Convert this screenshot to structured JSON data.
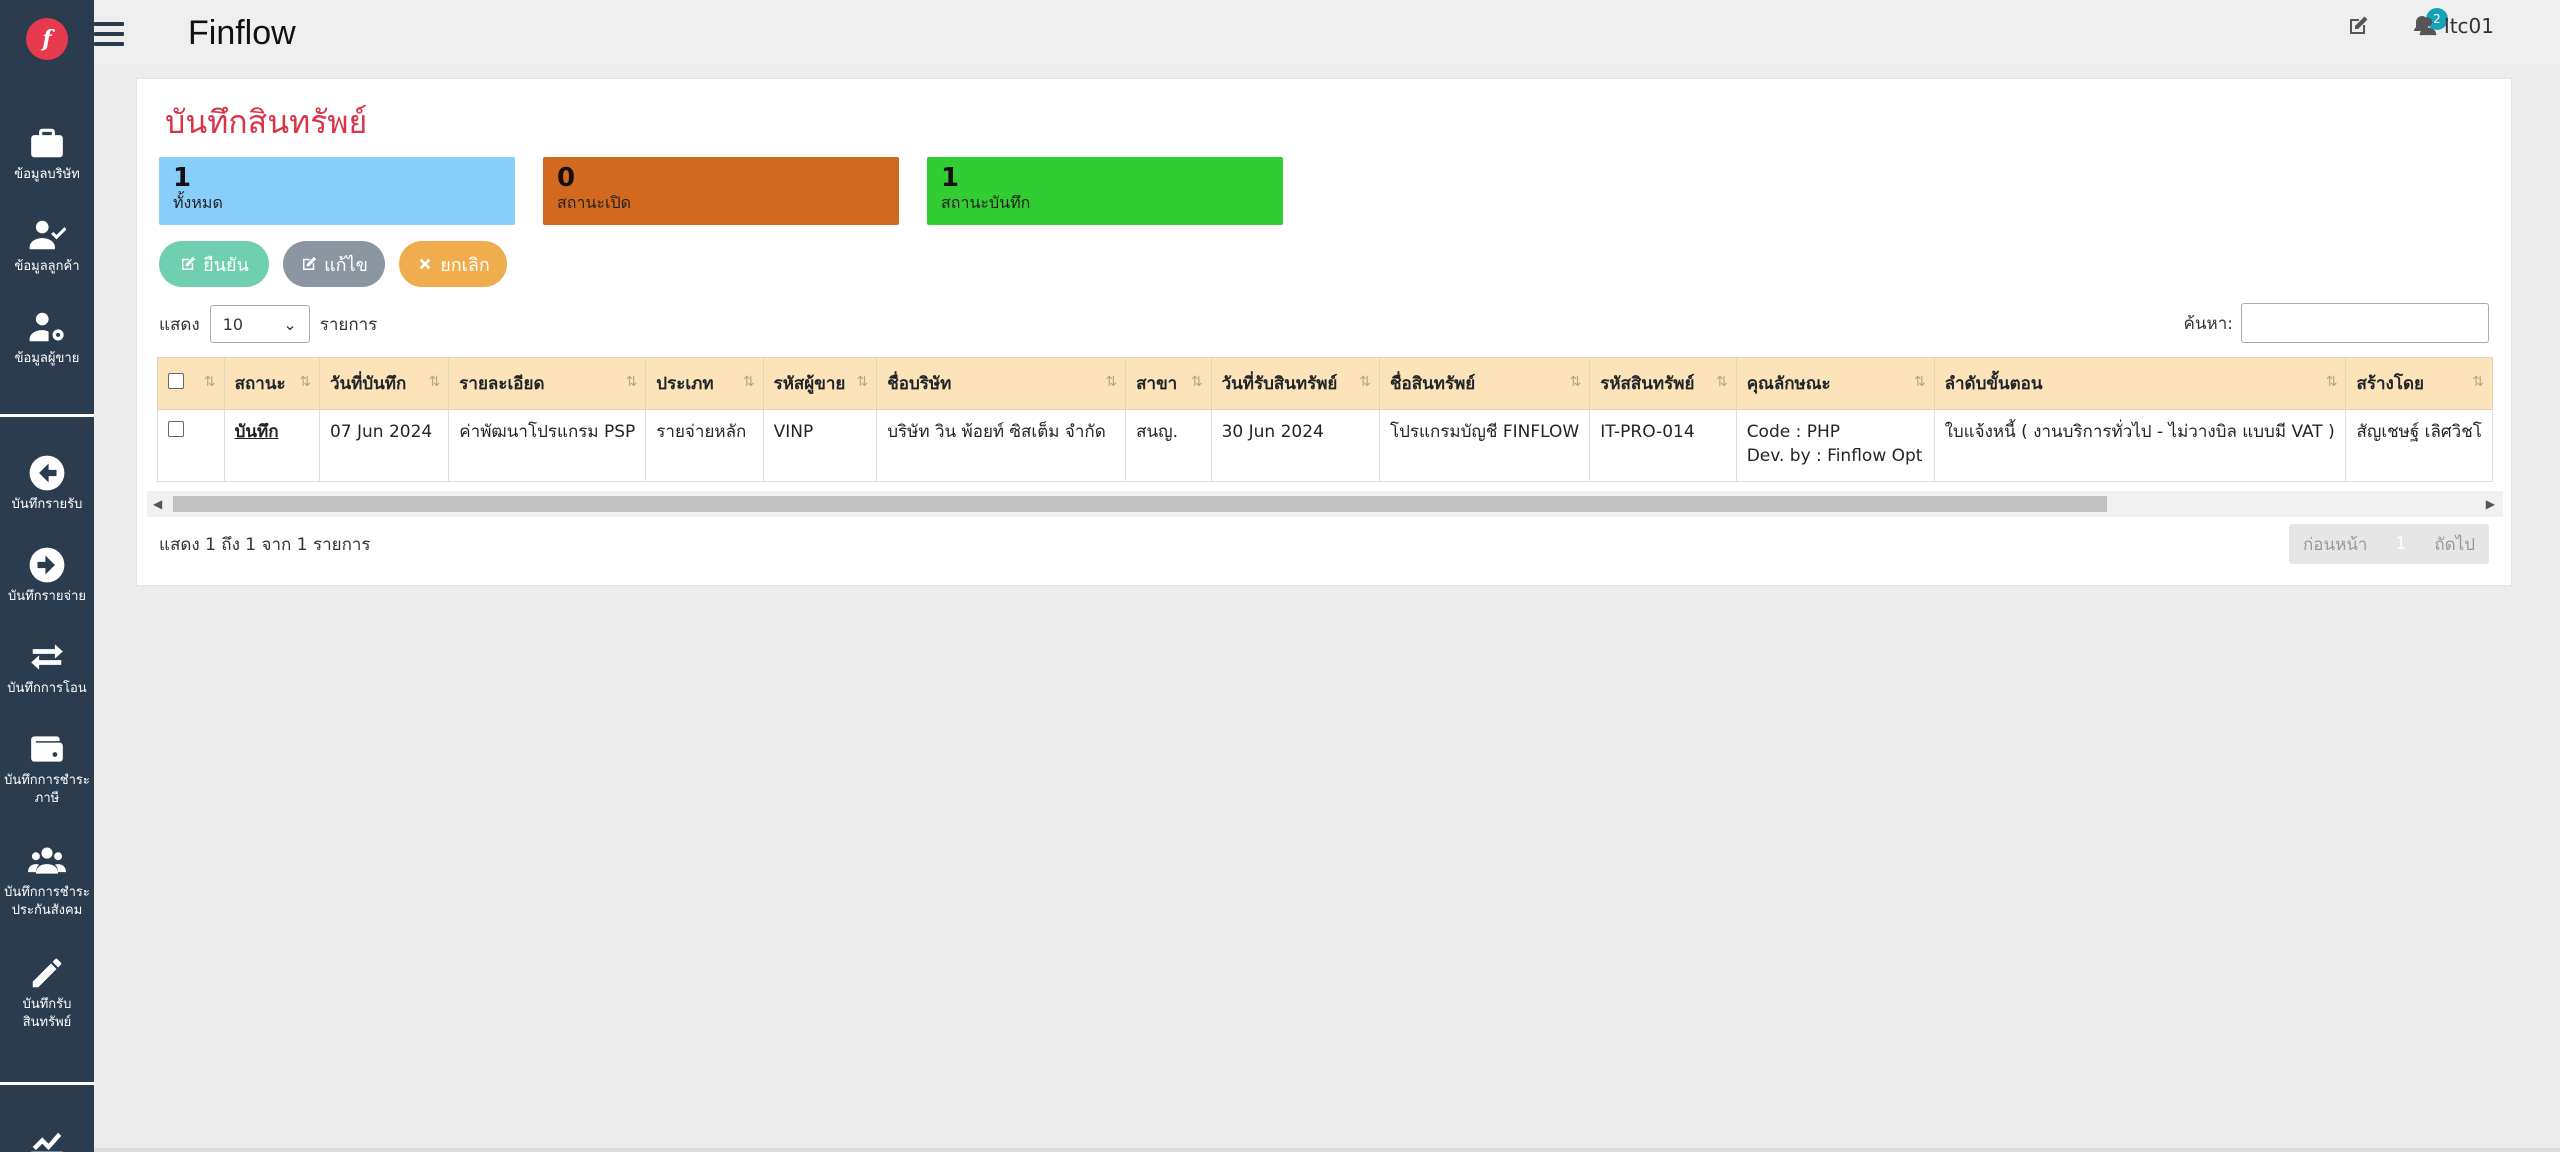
{
  "app": {
    "brand": "Finflow",
    "logo_letter": "f",
    "accent": "#d9344a"
  },
  "sidebar": {
    "items": [
      {
        "label": "ข้อมูลบริษัท",
        "icon": "briefcase-icon"
      },
      {
        "label": "ข้อมูลลูกค้า",
        "icon": "user-check-icon"
      },
      {
        "label": "ข้อมูลผู้ขาย",
        "icon": "user-gear-icon"
      },
      {
        "label": "บันทึกรายรับ",
        "icon": "arrow-left-circle-icon"
      },
      {
        "label": "บันทึกรายจ่าย",
        "icon": "arrow-right-circle-icon"
      },
      {
        "label": "บันทึกการโอน",
        "icon": "exchange-icon"
      },
      {
        "label": "บันทึกการชำระภาษี",
        "icon": "wallet-icon"
      },
      {
        "label": "บันทึกการชำระประกันสังคม",
        "icon": "users-icon"
      },
      {
        "label": "บันทึกรับสินทรัพย์",
        "icon": "pencil-icon"
      },
      {
        "label": "",
        "icon": "chart-line-icon"
      }
    ]
  },
  "topbar": {
    "notification_count": "2",
    "username": "Itc01"
  },
  "page": {
    "title": "บันทึกสินทรัพย์"
  },
  "stats": [
    {
      "value": "1",
      "label": "ทั้งหมด",
      "color": "#87cefa"
    },
    {
      "value": "0",
      "label": "สถานะเปิด",
      "color": "#d2691e"
    },
    {
      "value": "1",
      "label": "สถานะบันทึก",
      "color": "#32cd32"
    }
  ],
  "actions": {
    "confirm": "ยืนยัน",
    "edit": "แก้ไข",
    "cancel": "ยกเลิก"
  },
  "table_controls": {
    "show_label": "แสดง",
    "page_size": "10",
    "entries_label": "รายการ",
    "search_label": "ค้นหา:",
    "search_value": ""
  },
  "table": {
    "headers": [
      "สถานะ",
      "วันที่บันทึก",
      "รายละเอียด",
      "ประเภท",
      "รหัสผู้ขาย",
      "ชื่อบริษัท",
      "สาขา",
      "วันที่รับสินทรัพย์",
      "ชื่อสินทรัพย์",
      "รหัสสินทรัพย์",
      "คุณลักษณะ",
      "ลำดับขั้นตอน",
      "สร้างโดย"
    ],
    "rows": [
      {
        "status": "บันทึก",
        "record_date": "07 Jun 2024",
        "detail": "ค่าพัฒนาโปรแกรม PSP",
        "type": "รายจ่ายหลัก",
        "vendor_code": "VINP",
        "company": "บริษัท วิน พ้อยท์ ซิสเต็ม จำกัด",
        "branch": "สนญ.",
        "receive_date": "30 Jun 2024",
        "asset_name": "โปรแกรมบัญชี FINFLOW",
        "asset_code": "IT-PRO-014",
        "attr_line1": "Code : PHP",
        "attr_line2": "Dev. by : Finflow Opt",
        "process": "ใบแจ้งหนี้ ( งานบริการทั่วไป - ไม่วางบิล แบบมี VAT )",
        "created_by": "สัญเชษฐ์ เลิศวิชโ"
      }
    ]
  },
  "footer": {
    "info": "แสดง 1 ถึง 1 จาก 1 รายการ",
    "prev": "ก่อนหน้า",
    "page": "1",
    "next": "ถัดไป"
  }
}
